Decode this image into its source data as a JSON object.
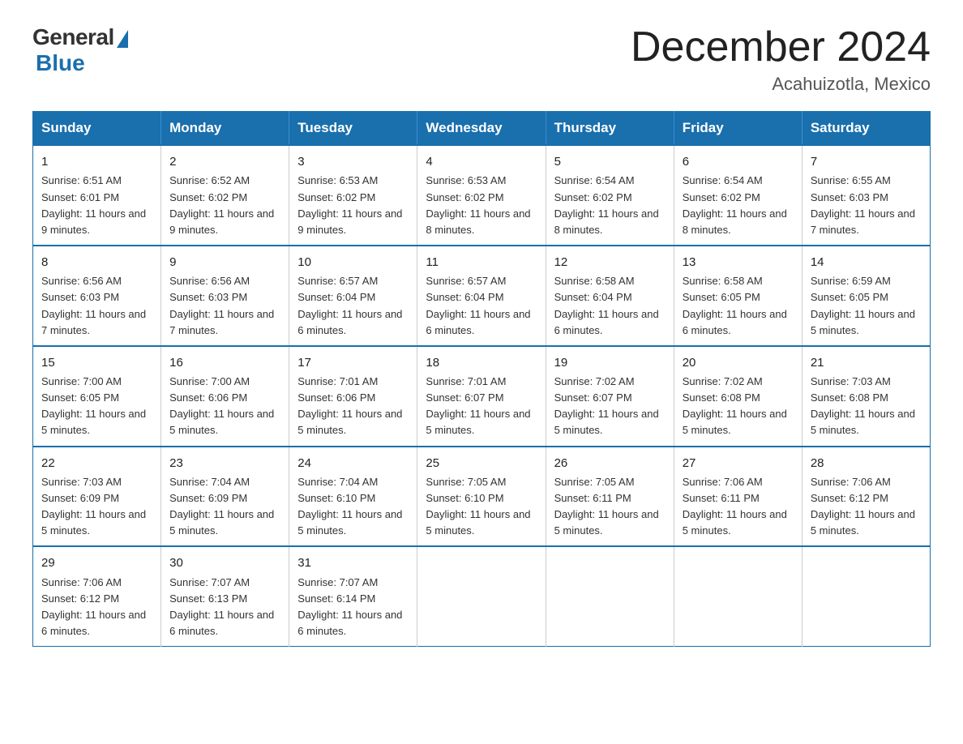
{
  "header": {
    "logo_general": "General",
    "logo_blue": "Blue",
    "month_title": "December 2024",
    "location": "Acahuizotla, Mexico"
  },
  "weekdays": [
    "Sunday",
    "Monday",
    "Tuesday",
    "Wednesday",
    "Thursday",
    "Friday",
    "Saturday"
  ],
  "weeks": [
    [
      {
        "day": "1",
        "sunrise": "6:51 AM",
        "sunset": "6:01 PM",
        "daylight": "11 hours and 9 minutes."
      },
      {
        "day": "2",
        "sunrise": "6:52 AM",
        "sunset": "6:02 PM",
        "daylight": "11 hours and 9 minutes."
      },
      {
        "day": "3",
        "sunrise": "6:53 AM",
        "sunset": "6:02 PM",
        "daylight": "11 hours and 9 minutes."
      },
      {
        "day": "4",
        "sunrise": "6:53 AM",
        "sunset": "6:02 PM",
        "daylight": "11 hours and 8 minutes."
      },
      {
        "day": "5",
        "sunrise": "6:54 AM",
        "sunset": "6:02 PM",
        "daylight": "11 hours and 8 minutes."
      },
      {
        "day": "6",
        "sunrise": "6:54 AM",
        "sunset": "6:02 PM",
        "daylight": "11 hours and 8 minutes."
      },
      {
        "day": "7",
        "sunrise": "6:55 AM",
        "sunset": "6:03 PM",
        "daylight": "11 hours and 7 minutes."
      }
    ],
    [
      {
        "day": "8",
        "sunrise": "6:56 AM",
        "sunset": "6:03 PM",
        "daylight": "11 hours and 7 minutes."
      },
      {
        "day": "9",
        "sunrise": "6:56 AM",
        "sunset": "6:03 PM",
        "daylight": "11 hours and 7 minutes."
      },
      {
        "day": "10",
        "sunrise": "6:57 AM",
        "sunset": "6:04 PM",
        "daylight": "11 hours and 6 minutes."
      },
      {
        "day": "11",
        "sunrise": "6:57 AM",
        "sunset": "6:04 PM",
        "daylight": "11 hours and 6 minutes."
      },
      {
        "day": "12",
        "sunrise": "6:58 AM",
        "sunset": "6:04 PM",
        "daylight": "11 hours and 6 minutes."
      },
      {
        "day": "13",
        "sunrise": "6:58 AM",
        "sunset": "6:05 PM",
        "daylight": "11 hours and 6 minutes."
      },
      {
        "day": "14",
        "sunrise": "6:59 AM",
        "sunset": "6:05 PM",
        "daylight": "11 hours and 5 minutes."
      }
    ],
    [
      {
        "day": "15",
        "sunrise": "7:00 AM",
        "sunset": "6:05 PM",
        "daylight": "11 hours and 5 minutes."
      },
      {
        "day": "16",
        "sunrise": "7:00 AM",
        "sunset": "6:06 PM",
        "daylight": "11 hours and 5 minutes."
      },
      {
        "day": "17",
        "sunrise": "7:01 AM",
        "sunset": "6:06 PM",
        "daylight": "11 hours and 5 minutes."
      },
      {
        "day": "18",
        "sunrise": "7:01 AM",
        "sunset": "6:07 PM",
        "daylight": "11 hours and 5 minutes."
      },
      {
        "day": "19",
        "sunrise": "7:02 AM",
        "sunset": "6:07 PM",
        "daylight": "11 hours and 5 minutes."
      },
      {
        "day": "20",
        "sunrise": "7:02 AM",
        "sunset": "6:08 PM",
        "daylight": "11 hours and 5 minutes."
      },
      {
        "day": "21",
        "sunrise": "7:03 AM",
        "sunset": "6:08 PM",
        "daylight": "11 hours and 5 minutes."
      }
    ],
    [
      {
        "day": "22",
        "sunrise": "7:03 AM",
        "sunset": "6:09 PM",
        "daylight": "11 hours and 5 minutes."
      },
      {
        "day": "23",
        "sunrise": "7:04 AM",
        "sunset": "6:09 PM",
        "daylight": "11 hours and 5 minutes."
      },
      {
        "day": "24",
        "sunrise": "7:04 AM",
        "sunset": "6:10 PM",
        "daylight": "11 hours and 5 minutes."
      },
      {
        "day": "25",
        "sunrise": "7:05 AM",
        "sunset": "6:10 PM",
        "daylight": "11 hours and 5 minutes."
      },
      {
        "day": "26",
        "sunrise": "7:05 AM",
        "sunset": "6:11 PM",
        "daylight": "11 hours and 5 minutes."
      },
      {
        "day": "27",
        "sunrise": "7:06 AM",
        "sunset": "6:11 PM",
        "daylight": "11 hours and 5 minutes."
      },
      {
        "day": "28",
        "sunrise": "7:06 AM",
        "sunset": "6:12 PM",
        "daylight": "11 hours and 5 minutes."
      }
    ],
    [
      {
        "day": "29",
        "sunrise": "7:06 AM",
        "sunset": "6:12 PM",
        "daylight": "11 hours and 6 minutes."
      },
      {
        "day": "30",
        "sunrise": "7:07 AM",
        "sunset": "6:13 PM",
        "daylight": "11 hours and 6 minutes."
      },
      {
        "day": "31",
        "sunrise": "7:07 AM",
        "sunset": "6:14 PM",
        "daylight": "11 hours and 6 minutes."
      },
      null,
      null,
      null,
      null
    ]
  ]
}
